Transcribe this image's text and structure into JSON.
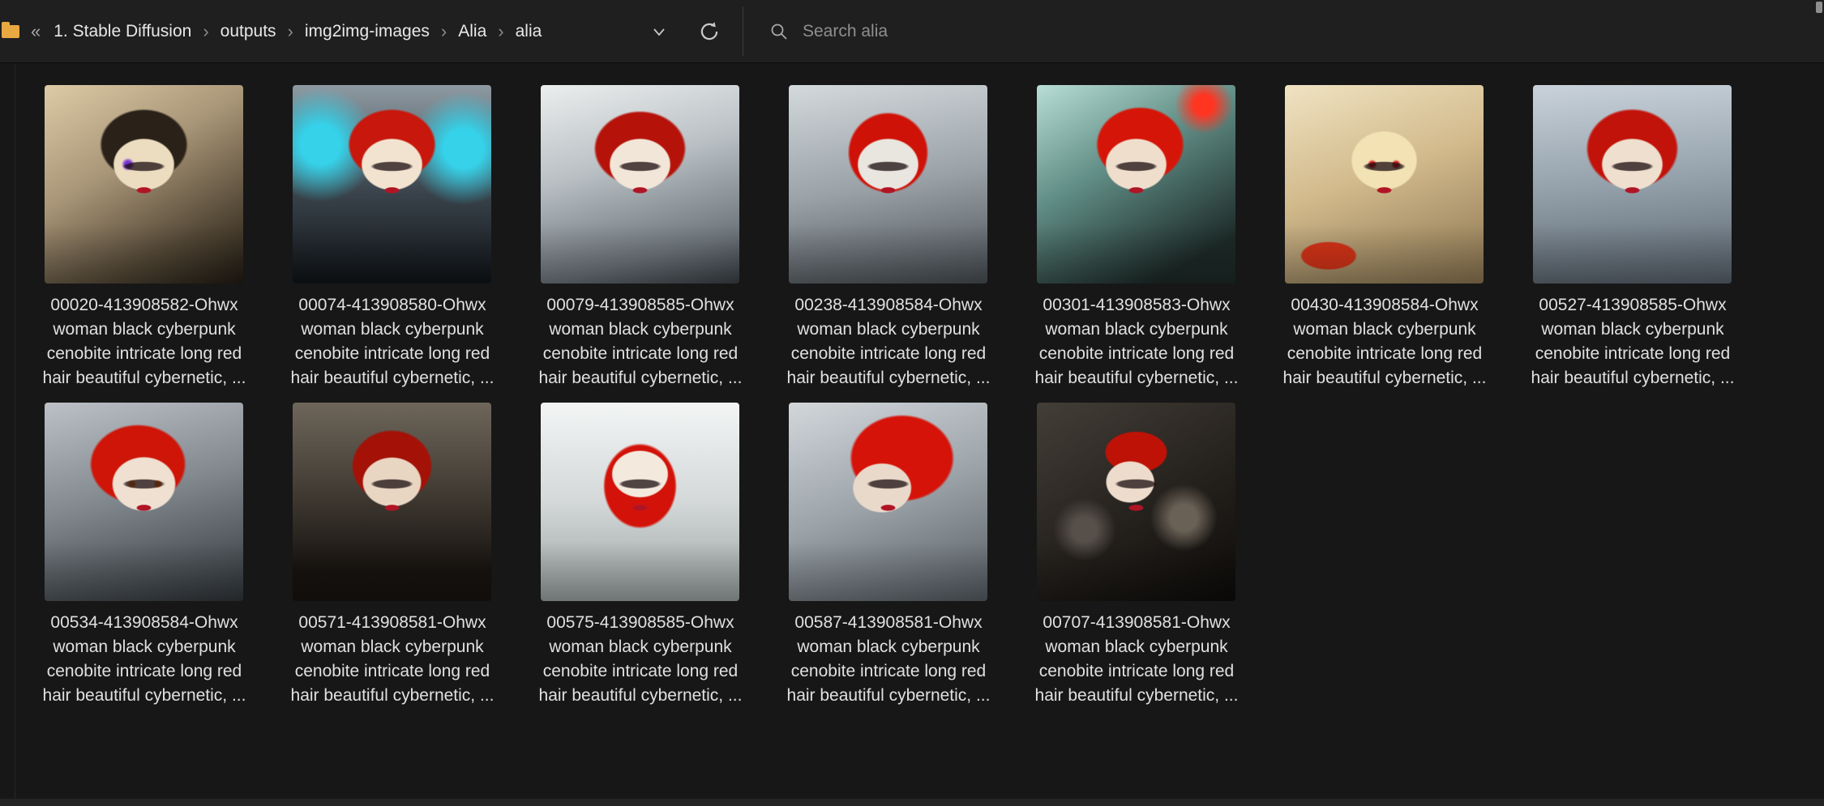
{
  "address": {
    "collapse_glyph": "«",
    "separator": "›",
    "breadcrumb": [
      "1. Stable Diffusion",
      "outputs",
      "img2img-images",
      "Alia",
      "alia"
    ]
  },
  "search": {
    "placeholder": "Search alia"
  },
  "files": [
    {
      "name": "00020-413908582-Ohwx woman black cyberpunk cenobite intricate long red hair beautiful cybernetic, ..."
    },
    {
      "name": "00074-413908580-Ohwx woman black cyberpunk cenobite intricate long red hair beautiful cybernetic, ..."
    },
    {
      "name": "00079-413908585-Ohwx woman black cyberpunk cenobite intricate long red hair beautiful cybernetic, ..."
    },
    {
      "name": "00238-413908584-Ohwx woman black cyberpunk cenobite intricate long red hair beautiful cybernetic, ..."
    },
    {
      "name": "00301-413908583-Ohwx woman black cyberpunk cenobite intricate long red hair beautiful cybernetic, ..."
    },
    {
      "name": "00430-413908584-Ohwx woman black cyberpunk cenobite intricate long red hair beautiful cybernetic, ..."
    },
    {
      "name": "00527-413908585-Ohwx woman black cyberpunk cenobite intricate long red hair beautiful cybernetic, ..."
    },
    {
      "name": "00534-413908584-Ohwx woman black cyberpunk cenobite intricate long red hair beautiful cybernetic, ..."
    },
    {
      "name": "00571-413908581-Ohwx woman black cyberpunk cenobite intricate long red hair beautiful cybernetic, ..."
    },
    {
      "name": "00575-413908585-Ohwx woman black cyberpunk cenobite intricate long red hair beautiful cybernetic, ..."
    },
    {
      "name": "00587-413908581-Ohwx woman black cyberpunk cenobite intricate long red hair beautiful cybernetic, ..."
    },
    {
      "name": "00707-413908581-Ohwx woman black cyberpunk cenobite intricate long red hair beautiful cybernetic, ..."
    }
  ]
}
